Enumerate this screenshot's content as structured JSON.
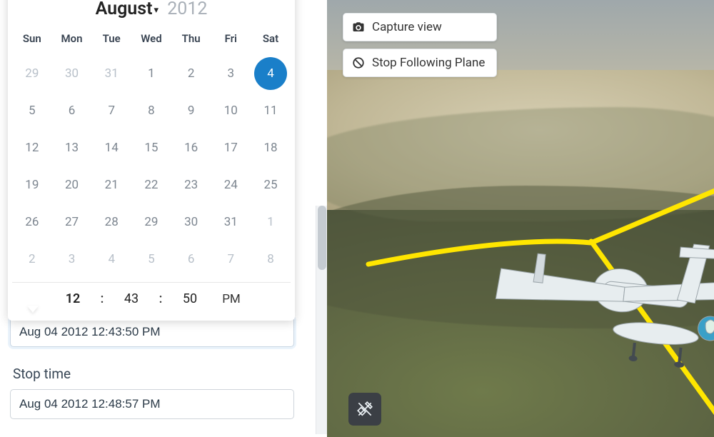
{
  "calendar": {
    "month": "August",
    "year": "2012",
    "weekdays": [
      "Sun",
      "Mon",
      "Tue",
      "Wed",
      "Thu",
      "Fri",
      "Sat"
    ],
    "rows": [
      [
        {
          "n": "29",
          "other": true
        },
        {
          "n": "30",
          "other": true
        },
        {
          "n": "31",
          "other": true
        },
        {
          "n": "1"
        },
        {
          "n": "2"
        },
        {
          "n": "3"
        },
        {
          "n": "4",
          "selected": true
        }
      ],
      [
        {
          "n": "5"
        },
        {
          "n": "6"
        },
        {
          "n": "7"
        },
        {
          "n": "8"
        },
        {
          "n": "9"
        },
        {
          "n": "10"
        },
        {
          "n": "11"
        }
      ],
      [
        {
          "n": "12"
        },
        {
          "n": "13"
        },
        {
          "n": "14"
        },
        {
          "n": "15"
        },
        {
          "n": "16"
        },
        {
          "n": "17"
        },
        {
          "n": "18"
        }
      ],
      [
        {
          "n": "19"
        },
        {
          "n": "20"
        },
        {
          "n": "21"
        },
        {
          "n": "22"
        },
        {
          "n": "23"
        },
        {
          "n": "24"
        },
        {
          "n": "25"
        }
      ],
      [
        {
          "n": "26"
        },
        {
          "n": "27"
        },
        {
          "n": "28"
        },
        {
          "n": "29"
        },
        {
          "n": "30"
        },
        {
          "n": "31"
        },
        {
          "n": "1",
          "other": true
        }
      ],
      [
        {
          "n": "2",
          "other": true
        },
        {
          "n": "3",
          "other": true
        },
        {
          "n": "4",
          "other": true
        },
        {
          "n": "5",
          "other": true
        },
        {
          "n": "6",
          "other": true
        },
        {
          "n": "7",
          "other": true
        },
        {
          "n": "8",
          "other": true
        }
      ]
    ],
    "time": {
      "hour": "12",
      "minute": "43",
      "second": "50",
      "ampm": "PM"
    }
  },
  "start_time_value": "Aug 04 2012 12:43:50 PM",
  "stop_time_label": "Stop time",
  "stop_time_value": "Aug 04 2012 12:48:57 PM",
  "map": {
    "capture_label": "Capture view",
    "stop_follow_label": "Stop Following Plane"
  }
}
